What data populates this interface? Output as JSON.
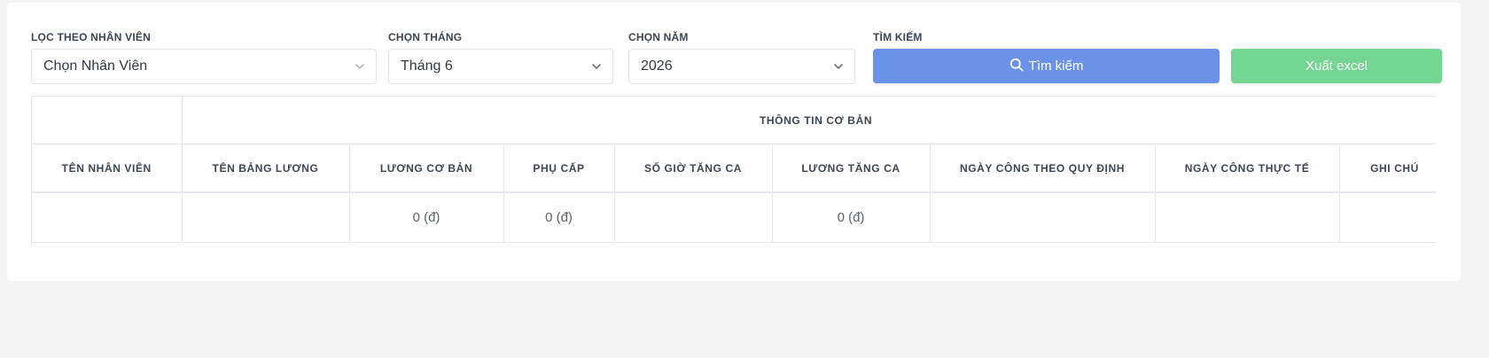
{
  "filters": {
    "employee": {
      "label": "LỌC THEO NHÂN VIÊN",
      "value": "Chọn Nhân Viên"
    },
    "month": {
      "label": "CHỌN THÁNG",
      "value": "Tháng 6"
    },
    "year": {
      "label": "CHỌN NĂM",
      "value": "2026"
    },
    "search": {
      "label": "TÌM KIẾM"
    }
  },
  "buttons": {
    "search_label": "Tìm kiếm",
    "export_label": "Xuất excel"
  },
  "table": {
    "group_header": "THÔNG TIN CƠ BẢN",
    "columns": [
      "TÊN NHÂN VIÊN",
      "TÊN BẢNG LƯƠNG",
      "LƯƠNG CƠ BẢN",
      "PHỤ CẤP",
      "SỐ GIỜ TĂNG CA",
      "LƯƠNG TĂNG CA",
      "NGÀY CÔNG THEO QUY ĐỊNH",
      "NGÀY CÔNG THỰC TẾ",
      "GHI CHÚ"
    ],
    "rows": [
      [
        "",
        "",
        "0 (đ)",
        "0 (đ)",
        "",
        "0 (đ)",
        "",
        "",
        ""
      ]
    ]
  },
  "colors": {
    "search_button": "#6a92e6",
    "export_button": "#74d491",
    "background": "#f2f3f2"
  },
  "icons": {
    "select_chevron": "chevron-down-icon",
    "search": "search-icon"
  }
}
